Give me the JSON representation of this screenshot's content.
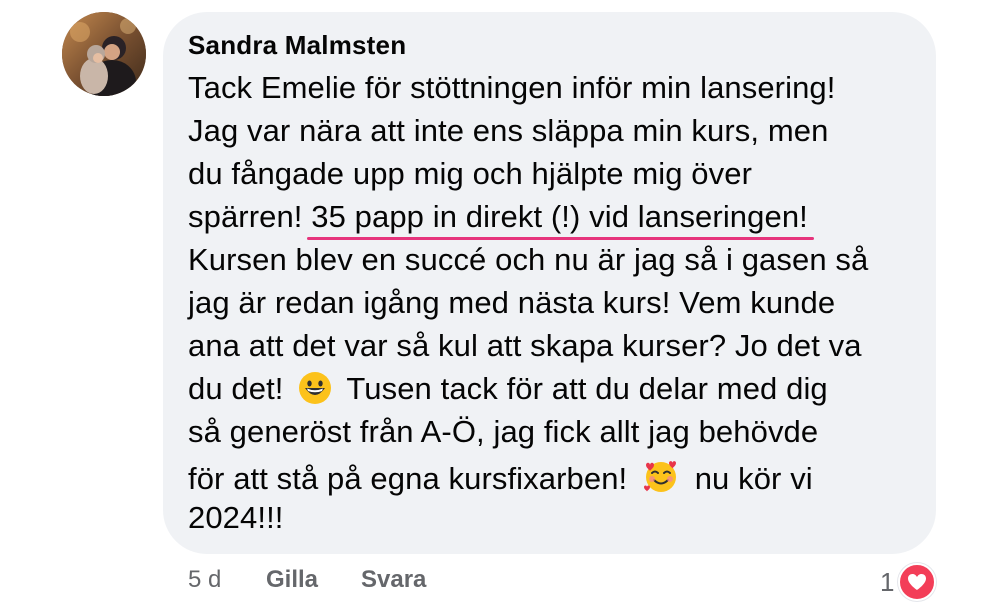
{
  "comment": {
    "author": "Sandra Malmsten",
    "lines": [
      "Tack Emelie för stöttningen inför min lansering!",
      "Jag var nära att inte ens släppa min kurs, men",
      "du fångade upp mig och hjälpte mig över",
      "Kursen blev en succé och nu är jag så i gasen så",
      "jag är redan igång med nästa kurs! Vem kunde",
      "ana att det var så kul att skapa kurser? Jo det va",
      "så generöst från A-Ö, jag fick allt jag behövde",
      "2024!!!"
    ],
    "line4_prefix": "spärren!",
    "line4_highlight": "35 papp in direkt (!) vid lanseringen!",
    "line8_before": "du det!",
    "line8_after": "Tusen tack för att du delar med dig",
    "line10_before": "för att stå på egna kursfixarben!",
    "line10_after": "nu kör vi",
    "emoji_1": "grinning-face-emoji",
    "emoji_2": "smiling-face-with-hearts-emoji",
    "highlight_color": "#e6347c"
  },
  "actions": {
    "time": "5 d",
    "like": "Gilla",
    "reply": "Svara"
  },
  "reactions": {
    "count": "1",
    "type": "heart-icon",
    "color": "#f33e58"
  }
}
